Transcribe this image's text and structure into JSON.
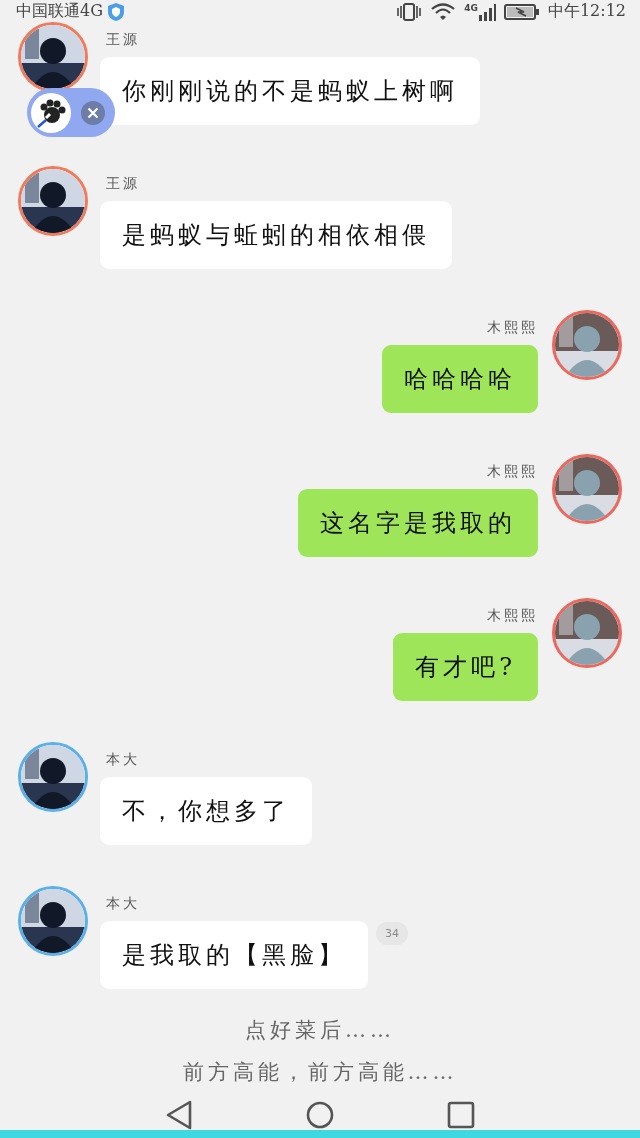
{
  "status_bar": {
    "carrier": "中国联通4G",
    "signal_label": "4G",
    "time": "中午12:12"
  },
  "messages": [
    {
      "kind": "incoming",
      "sender": "王源",
      "text": "你刚刚说的不是蚂蚁上树啊",
      "color": "#f07a5a"
    },
    {
      "kind": "incoming",
      "sender": "王源",
      "text": "是蚂蚁与蚯蚓的相依相偎",
      "color": "#f07a5a"
    },
    {
      "kind": "outgoing",
      "sender": "木熙熙",
      "text": "哈哈哈哈",
      "color": "#f0665a"
    },
    {
      "kind": "outgoing",
      "sender": "木熙熙",
      "text": "这名字是我取的",
      "color": "#f0665a"
    },
    {
      "kind": "outgoing",
      "sender": "木熙熙",
      "text": "有才吧?",
      "color": "#f0665a"
    },
    {
      "kind": "incoming",
      "sender": "本大",
      "text": "不，你想多了",
      "color": "#5ab0e8"
    },
    {
      "kind": "incoming",
      "sender": "本大",
      "text": "是我取的【黑脸】",
      "color": "#5ab0e8",
      "badge": "34"
    }
  ],
  "captions": [
    "点好菜后……",
    "前方高能，前方高能……"
  ]
}
